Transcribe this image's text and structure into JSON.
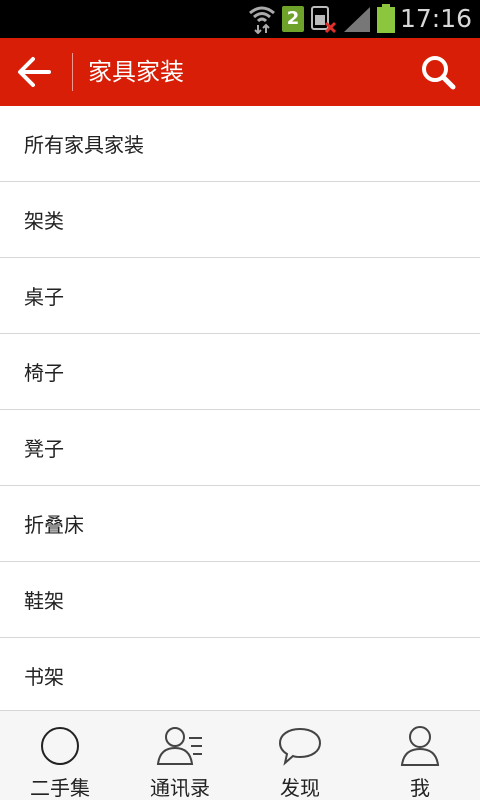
{
  "status_bar": {
    "time": "17:16",
    "sim_badge": "2",
    "icons": [
      "wifi-data-icon",
      "sim2-icon",
      "no-sim-icon",
      "signal-icon",
      "battery-icon"
    ]
  },
  "header": {
    "title": "家具家装",
    "back_icon": "arrow-left-icon",
    "search_icon": "search-icon",
    "color": "#d81e06"
  },
  "categories": [
    "所有家具家装",
    "架类",
    "桌子",
    "椅子",
    "凳子",
    "折叠床",
    "鞋架",
    "书架"
  ],
  "bottom_nav": {
    "items": [
      {
        "label": "二手集",
        "icon": "circle-icon"
      },
      {
        "label": "通讯录",
        "icon": "contacts-icon"
      },
      {
        "label": "发现",
        "icon": "chat-bubble-icon"
      },
      {
        "label": "我",
        "icon": "person-icon"
      }
    ]
  }
}
